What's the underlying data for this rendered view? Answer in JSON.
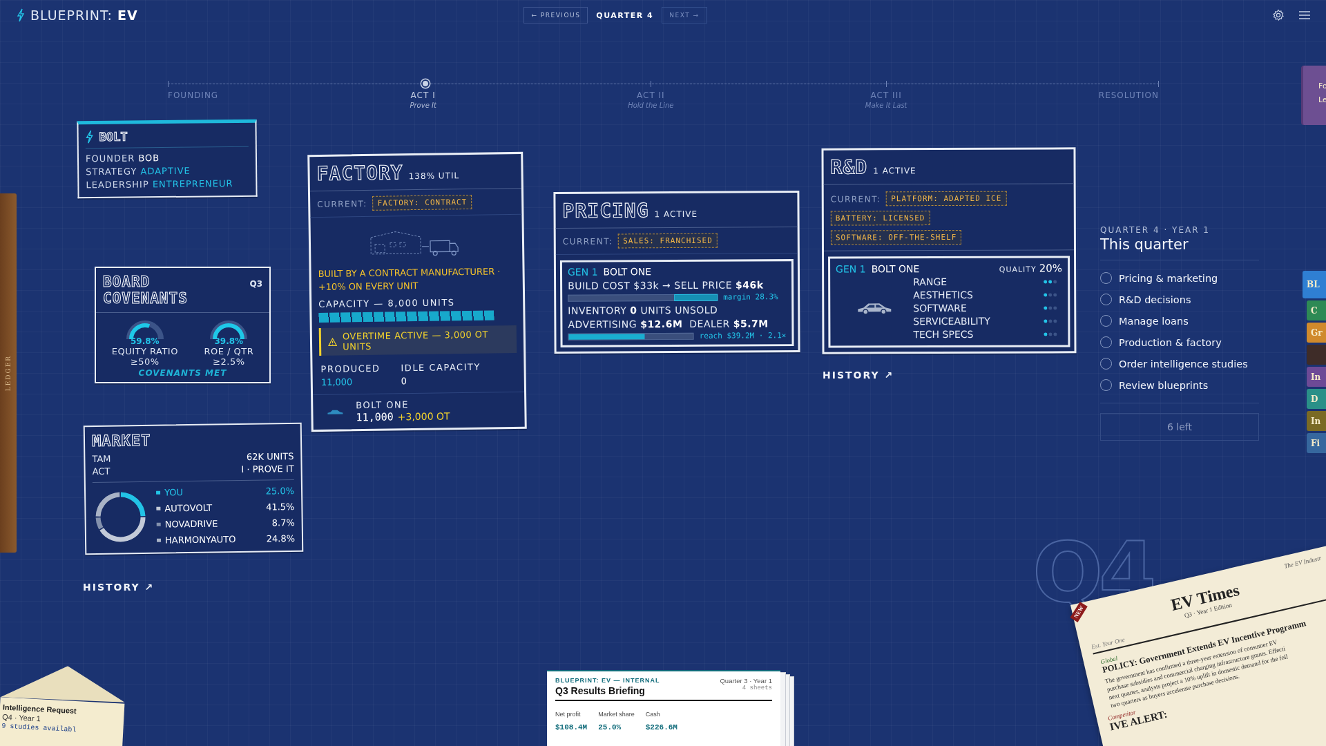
{
  "header": {
    "logo_prefix": "BLUEPRINT:",
    "logo_suffix": "EV",
    "previous": "← PREVIOUS",
    "quarter": "QUARTER 4",
    "next": "NEXT →",
    "next_disabled": true
  },
  "timeline": {
    "level": 0.26,
    "stops": [
      {
        "label": "FOUNDING"
      },
      {
        "label": "ACT I",
        "subtitle": "Prove It"
      },
      {
        "label": "ACT II",
        "subtitle": "Hold the Line"
      },
      {
        "label": "ACT III",
        "subtitle": "Make It Last"
      },
      {
        "label": "RESOLUTION"
      }
    ]
  },
  "company": {
    "name": "BOLT",
    "rows": [
      {
        "label": "FOUNDER",
        "value": "BOB",
        "kind": "plain"
      },
      {
        "label": "STRATEGY",
        "value": "ADAPTIVE",
        "kind": "accent"
      },
      {
        "label": "LEADERSHIP",
        "value": "ENTREPRENEUR",
        "kind": "accent"
      }
    ]
  },
  "covenants": {
    "title": "BOARD COVENANTS",
    "period": "Q3",
    "gauges": [
      {
        "value": "59.8%",
        "label": "EQUITY RATIO",
        "target": "≥50%",
        "level": 0.6
      },
      {
        "value": "39.8%",
        "label": "ROE / QTR",
        "target": "≥2.5%",
        "level": 1
      }
    ],
    "status": "COVENANTS MET"
  },
  "market": {
    "title": "MARKET",
    "rows": [
      {
        "label": "TAM",
        "value": "62K UNITS"
      },
      {
        "label": "ACT",
        "value": "I · PROVE IT"
      }
    ],
    "legend": [
      {
        "share": "25.0%",
        "color": "#22c3e6"
      },
      {
        "share": "41.5%",
        "color": "#c3cad8"
      },
      {
        "share": "8.7%",
        "color": "#8391ad"
      },
      {
        "share": "24.8%",
        "color": "#a9b3c6"
      }
    ],
    "chart_data": {
      "type": "donut",
      "categories": [
        "YOU",
        "AUTOVOLT",
        "NOVADRIVE",
        "HARMONYAUTO"
      ],
      "values": [
        25.0,
        41.5,
        8.7,
        24.8
      ]
    },
    "history": "HISTORY ↗"
  },
  "factory": {
    "title": "FACTORY",
    "badge": "138% UTIL",
    "current_label": "CURRENT:",
    "current": "FACTORY: CONTRACT",
    "note": "BUILT BY A CONTRACT MANUFACTURER · +10% ON EVERY UNIT",
    "capacity": {
      "label": "CAPACITY — 8,000 UNITS",
      "level": 1
    },
    "warning": "OVERTIME ACTIVE — 3,000 OT UNITS",
    "stats": [
      {
        "label": "PRODUCED",
        "value": "11,000",
        "kind": "accent"
      },
      {
        "label": "IDLE CAPACITY",
        "value": "0",
        "kind": "plain"
      }
    ],
    "product": {
      "name": "BOLT ONE",
      "units": "11,000",
      "overtime": "+3,000 OT"
    }
  },
  "pricing": {
    "title": "PRICING",
    "badge": "1 ACTIVE",
    "current_label": "CURRENT:",
    "current": "SALES: FRANCHISED",
    "model": {
      "gen": "GEN 1",
      "name": "BOLT ONE",
      "cost_line": "BUILD COST $33k → SELL PRICE **$46k**",
      "margin": {
        "level": 0.283,
        "text": "margin 28.3%"
      },
      "inventory": "INVENTORY **0** UNITS UNSOLD",
      "ads": "ADVERTISING **$12.6M**  DEALER **$5.7M**",
      "reach": {
        "level": 0.61,
        "text": "reach $39.2M · 2.1×"
      }
    }
  },
  "rnd": {
    "title": "R&D",
    "badge": "1 ACTIVE",
    "current_label": "CURRENT:",
    "tags": [
      "PLATFORM: ADAPTED ICE",
      "BATTERY: LICENSED",
      "SOFTWARE: OFF-THE-SHELF"
    ],
    "model": {
      "gen": "GEN 1",
      "name": "BOLT ONE",
      "quality_label": "QUALITY",
      "quality": "20%",
      "attributes": [
        {
          "name": "RANGE",
          "stars": 2
        },
        {
          "name": "AESTHETICS",
          "stars": 1
        },
        {
          "name": "SOFTWARE",
          "stars": 1
        },
        {
          "name": "SERVICEABILITY",
          "stars": 1
        },
        {
          "name": "TECH SPECS",
          "stars": 1
        }
      ]
    },
    "history": "HISTORY ↗"
  },
  "quarter_panel": {
    "kicker": "QUARTER 4 · YEAR 1",
    "title": "This quarter",
    "tasks": [
      {
        "label": "Pricing & marketing",
        "checked": false
      },
      {
        "label": "R&D decisions",
        "checked": false
      },
      {
        "label": "Manage loans",
        "checked": false
      },
      {
        "label": "Production & factory",
        "checked": false
      },
      {
        "label": "Order intelligence studies",
        "checked": false
      },
      {
        "label": "Review blueprints",
        "checked": false
      }
    ],
    "remaining": "6 left"
  },
  "pinned_note": {
    "lines": [
      "Fo",
      "Le"
    ]
  },
  "side_tabs": [
    {
      "label": "BL",
      "color": "#2f7fd3",
      "selected": true
    },
    {
      "label": "C",
      "color": "#2e8a55",
      "selected": false
    },
    {
      "label": "Gr",
      "color": "#d08a2c",
      "selected": false
    },
    {
      "color": "#3e2c28",
      "selected": false
    },
    {
      "label": "In",
      "color": "#6d4a96",
      "selected": false
    },
    {
      "label": "D",
      "color": "#2a9088",
      "selected": false
    },
    {
      "label": "In",
      "color": "#7a6a24",
      "selected": false
    },
    {
      "label": "Fi",
      "color": "#36679e",
      "selected": false
    }
  ],
  "ledger": {
    "label": "LEDGER"
  },
  "quarter_mark": "Q4",
  "briefing": {
    "kicker": "BLUEPRINT: EV — INTERNAL",
    "title": "Q3 Results Briefing",
    "period": "Quarter 3 · Year 1",
    "sheets": "4 sheets",
    "metrics": [
      {
        "label": "Net profit",
        "value": "$108.4M"
      },
      {
        "label": "Market share",
        "value": "25.0%"
      },
      {
        "label": "Cash",
        "value": "$226.6M"
      }
    ]
  },
  "intel": {
    "title": "Intelligence Request",
    "period": "Q4 · Year 1",
    "status": "9 studies availabl"
  },
  "newspaper": {
    "badge": "NEW",
    "tagline": "The EV Industr",
    "masthead": "EV Times",
    "edition": "Q3 · Year 1 Edition",
    "est": "Est. Year One",
    "section": "Global",
    "headline": "POLICY: Government Extends EV Incentive Programm",
    "body_lines": [
      "The government has confirmed a three-year extension of consumer EV",
      "purchase subsidies and commercial charging infrastructure grants. Effecti",
      "next quarter, analysts project a 10% uplift in domestic demand for the foll",
      "two quarters as buyers accelerate purchase decisions."
    ],
    "section_2": "Competitor",
    "headline_2": "IVE ALERT:"
  }
}
